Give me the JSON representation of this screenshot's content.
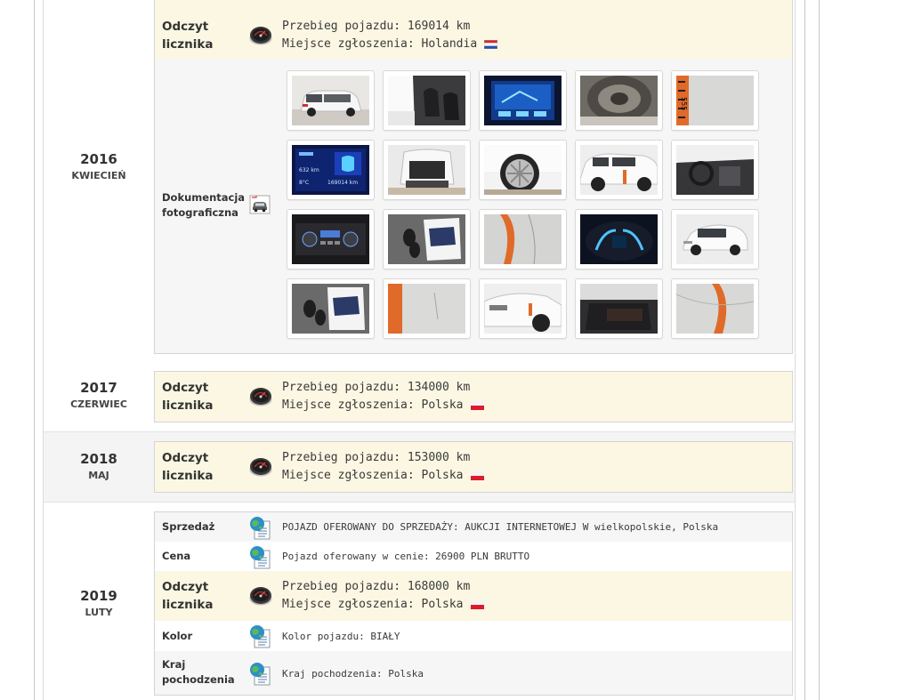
{
  "entries": {
    "e2016": {
      "year": "2016",
      "month": "KWIECIEŃ",
      "reading": {
        "label": "Odczyt licznika",
        "line1": "Przebieg pojazdu: 169014 km",
        "line2": "Miejsce zgłoszenia: Holandia"
      },
      "photos": {
        "label": "Dokumentacja fotograficzna"
      }
    },
    "e2017": {
      "year": "2017",
      "month": "CZERWIEC",
      "reading": {
        "label": "Odczyt licznika",
        "line1": "Przebieg pojazdu: 134000 km",
        "line2": "Miejsce zgłoszenia: Polska"
      }
    },
    "e2018": {
      "year": "2018",
      "month": "MAJ",
      "reading": {
        "label": "Odczyt licznika",
        "line1": "Przebieg pojazdu: 153000 km",
        "line2": "Miejsce zgłoszenia: Polska"
      }
    },
    "e2019": {
      "year": "2019",
      "month": "LUTY",
      "sale": {
        "label": "Sprzedaż",
        "value": "POJAZD OFEROWANY DO SPRZEDAŻY: AUKCJI INTERNETOWEJ W wielkopolskie, Polska"
      },
      "price": {
        "label": "Cena",
        "value": "Pojazd oferowany w cenie: 26900 PLN BRUTTO"
      },
      "reading": {
        "label": "Odczyt licznika",
        "line1": "Przebieg pojazdu: 168000 km",
        "line2": "Miejsce zgłoszenia: Polska"
      },
      "color": {
        "label": "Kolor",
        "value": "Kolor pojazdu: BIAŁY"
      },
      "origin": {
        "label": "Kraj pochodzenia",
        "value": "Kraj pochodzenia: Polska"
      }
    }
  },
  "thumb_text": {
    "speedo_km": "632 km",
    "speedo_odo": "169014 km",
    "speedo_temp": "8°C",
    "sticker": "555"
  },
  "icons": {
    "odometer": "odometer-icon",
    "camera": "car-photo-icon",
    "info": "globe-document-icon",
    "flag_nl": "netherlands-flag-icon",
    "flag_pl": "poland-flag-icon"
  },
  "colors": {
    "highlight_row": "#fbf7e3",
    "row_alt": "#f4f4f4",
    "border": "#d4d4d4"
  }
}
